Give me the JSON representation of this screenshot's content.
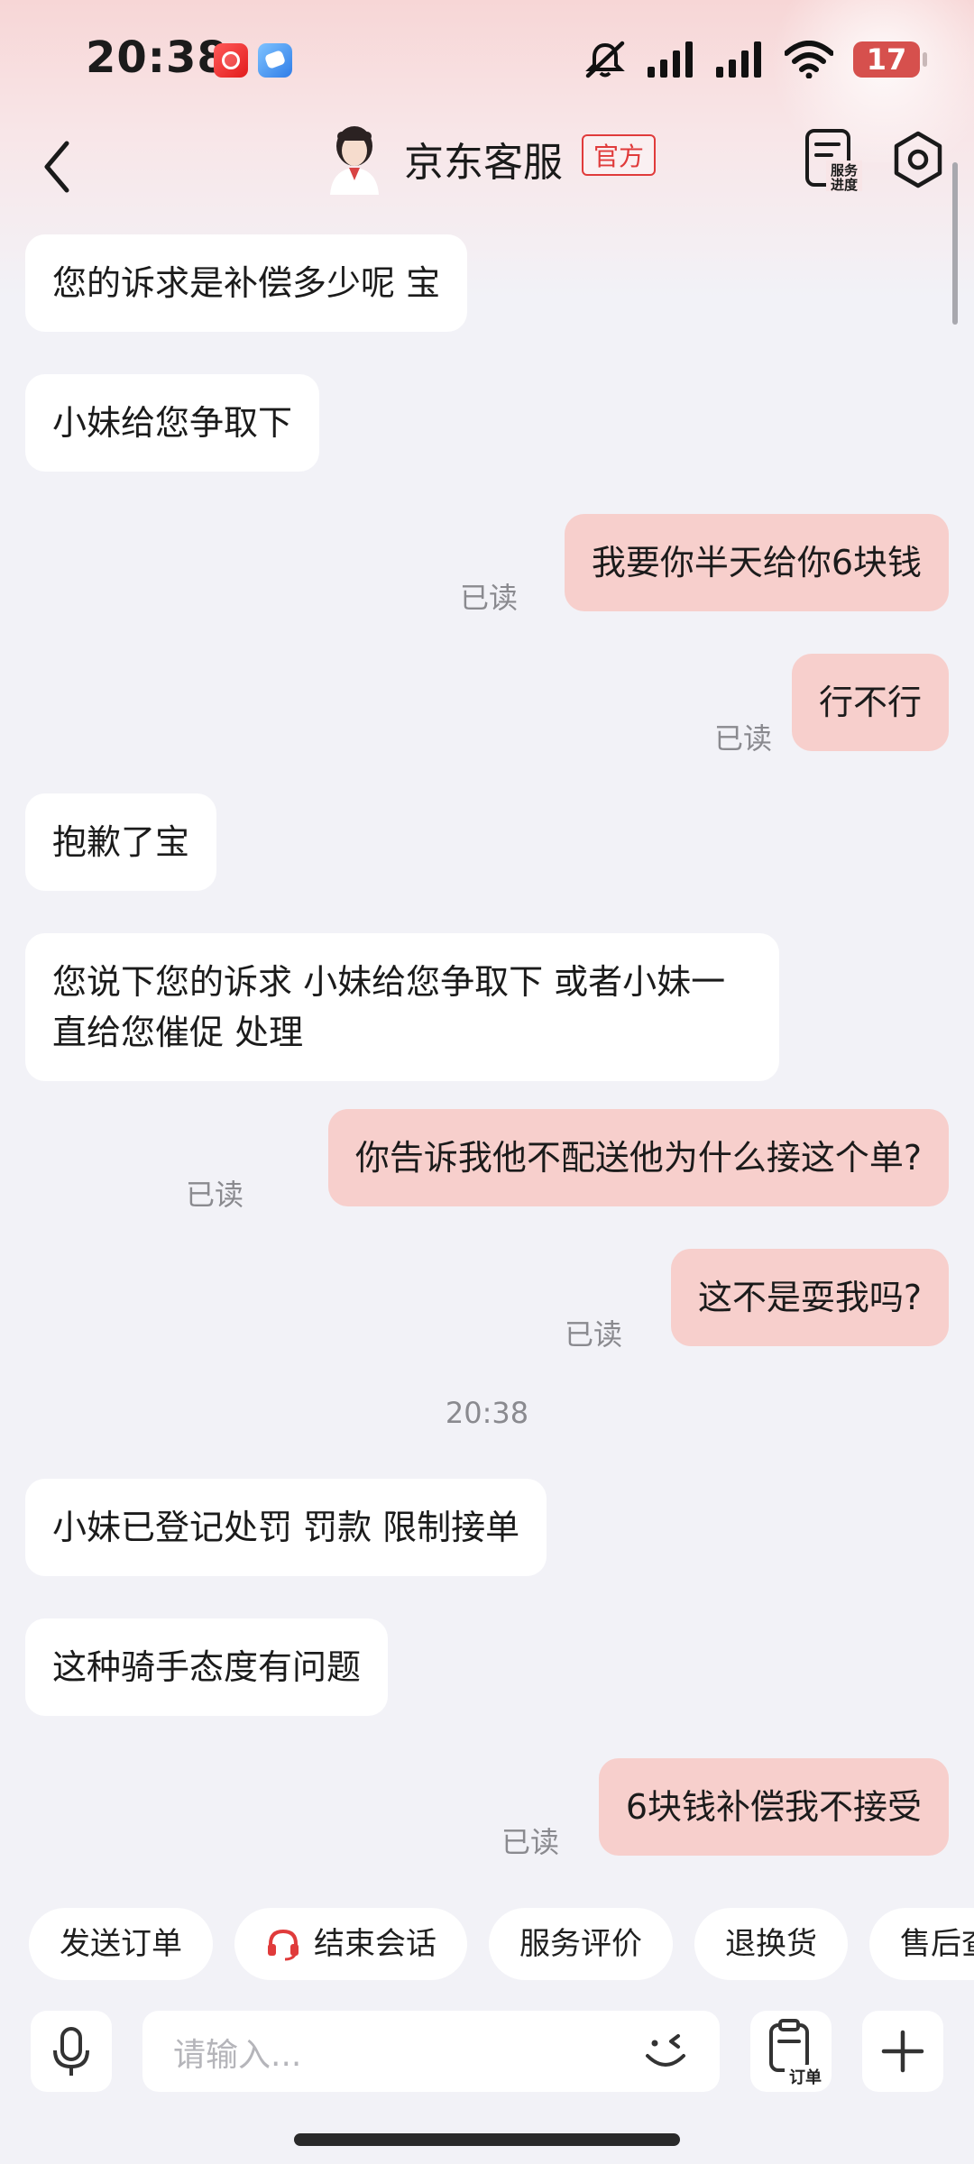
{
  "status_bar": {
    "time": "20:38",
    "battery": "17",
    "icons": [
      "mute-icon",
      "signal-icon",
      "signal-icon",
      "wifi-icon",
      "battery-icon"
    ]
  },
  "nav": {
    "title": "京东客服",
    "badge": "官方",
    "service_progress_label_line1": "服务",
    "service_progress_label_line2": "进度"
  },
  "messages": [
    {
      "side": "in",
      "text": "您的诉求是补偿多少呢 宝"
    },
    {
      "side": "in",
      "text": "小妹给您争取下"
    },
    {
      "side": "out",
      "text": "我要你半天给你6块钱",
      "status": "已读"
    },
    {
      "side": "out",
      "text": "行不行",
      "status": "已读"
    },
    {
      "side": "in",
      "text": "抱歉了宝"
    },
    {
      "side": "in",
      "text": "您说下您的诉求  小妹给您争取下  或者小妹一直给您催促 处理"
    },
    {
      "side": "out",
      "text": "你告诉我他不配送他为什么接这个单?",
      "status": "已读"
    },
    {
      "side": "out",
      "text": "这不是耍我吗?",
      "status": "已读"
    },
    {
      "side": "in",
      "text": "小妹已登记处罚  罚款 限制接单"
    },
    {
      "side": "in",
      "text": "这种骑手态度有问题"
    },
    {
      "side": "out",
      "text": "6块钱补偿我不接受",
      "status": "已读"
    }
  ],
  "timestamp": "20:38",
  "quick_actions": [
    "发送订单",
    "结束会话",
    "服务评价",
    "退换货",
    "售后查"
  ],
  "input": {
    "placeholder": "请输入...",
    "order_label": "订单"
  },
  "colors": {
    "outgoing_bubble": "#f7cfcc",
    "incoming_bubble": "#ffffff",
    "accent": "#e03b3b",
    "background": "#f2f2f7"
  }
}
